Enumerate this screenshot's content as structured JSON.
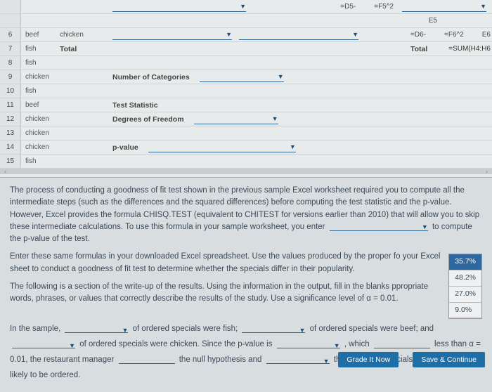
{
  "rows": [
    {
      "n": "6",
      "a": "beef",
      "b": "chicken",
      "right": [
        "=D6-",
        "=F6^2",
        "E6"
      ],
      "mid_dd": 2
    },
    {
      "n": "7",
      "a": "fish",
      "b": "Total",
      "right_bold": "Total",
      "right_formula": "=SUM(H4:H6"
    },
    {
      "n": "8",
      "a": "fish",
      "b": ""
    },
    {
      "n": "9",
      "a": "chicken",
      "b": "",
      "label": "Number of Categories",
      "dd": 1
    },
    {
      "n": "10",
      "a": "fish",
      "b": ""
    },
    {
      "n": "11",
      "a": "beef",
      "b": "",
      "label": "Test Statistic"
    },
    {
      "n": "12",
      "a": "chicken",
      "b": "",
      "label": "Degrees of Freedom",
      "dd": 1
    },
    {
      "n": "13",
      "a": "chicken",
      "b": ""
    },
    {
      "n": "14",
      "a": "chicken",
      "b": "",
      "label": "p-value",
      "dd": 1,
      "dd_wide": true
    },
    {
      "n": "15",
      "a": "fish",
      "b": ""
    }
  ],
  "top_right": [
    "=D5-",
    "=F5^2",
    "E5"
  ],
  "para1": "The process of conducting a goodness of fit test shown in the previous sample Excel worksheet required you to compute all the intermediate steps (such as the differences and the squared differences) before computing the test statistic and the p-value. However, Excel provides the formula CHISQ.TEST (equivalent to CHITEST for versions earlier than 2010) that will allow you to skip these intermediate calculations. To use this formula in your sample worksheet, you enter",
  "para1_tail": "to compute the p-value of the test.",
  "para2a": "Enter these same formulas in your downloaded Excel spreadsheet. Use the values produced by the proper fo",
  "para2b": "your Excel sheet to conduct a goodness of fit test to determine whether the specials differ in their popularity.",
  "para3a": "The following is a section of the write-up of the results. Using the information in the output, fill in the blanks",
  "para3b": "ppropriate words, phrases, or values that correctly describe the results of the study. Use a significance level of α = 0.01.",
  "options": [
    "35.7%",
    "48.2%",
    "27.0%",
    "9.0%"
  ],
  "fill": {
    "a": "In the sample,",
    "b": "of ordered specials were fish;",
    "c": "of ordered specials were beef; and",
    "d": "of ordered specials were chicken. Since the p-value is",
    "e": ", which",
    "f": "less than α = 0.01, the restaurant manager",
    "g": "the null hypothesis and",
    "h": "that the three specials are not equally likely to be ordered."
  },
  "buttons": {
    "grade": "Grade It Now",
    "save": "Save & Continue"
  }
}
